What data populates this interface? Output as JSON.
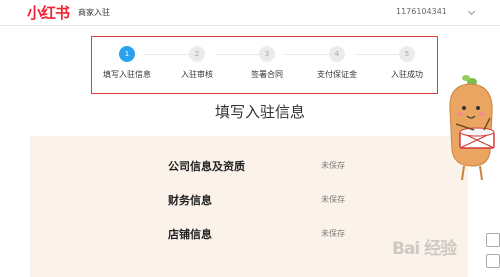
{
  "header": {
    "logo": "小红书",
    "title": "商家入驻",
    "account": "1176104341"
  },
  "steps": [
    {
      "num": "1",
      "label": "填写入驻信息",
      "active": true
    },
    {
      "num": "2",
      "label": "入驻审核",
      "active": false
    },
    {
      "num": "3",
      "label": "签署合同",
      "active": false
    },
    {
      "num": "4",
      "label": "支付保证金",
      "active": false
    },
    {
      "num": "5",
      "label": "入驻成功",
      "active": false
    }
  ],
  "page_title": "填写入驻信息",
  "sections": [
    {
      "title": "公司信息及资质",
      "status": "未保存"
    },
    {
      "title": "财务信息",
      "status": "未保存"
    },
    {
      "title": "店铺信息",
      "status": "未保存"
    }
  ],
  "watermark": "Bai 经验",
  "colors": {
    "brand": "#ef2533",
    "active_step": "#2aa3ef",
    "steps_border": "#e23a3a",
    "panel_bg": "#fbf3ea"
  }
}
